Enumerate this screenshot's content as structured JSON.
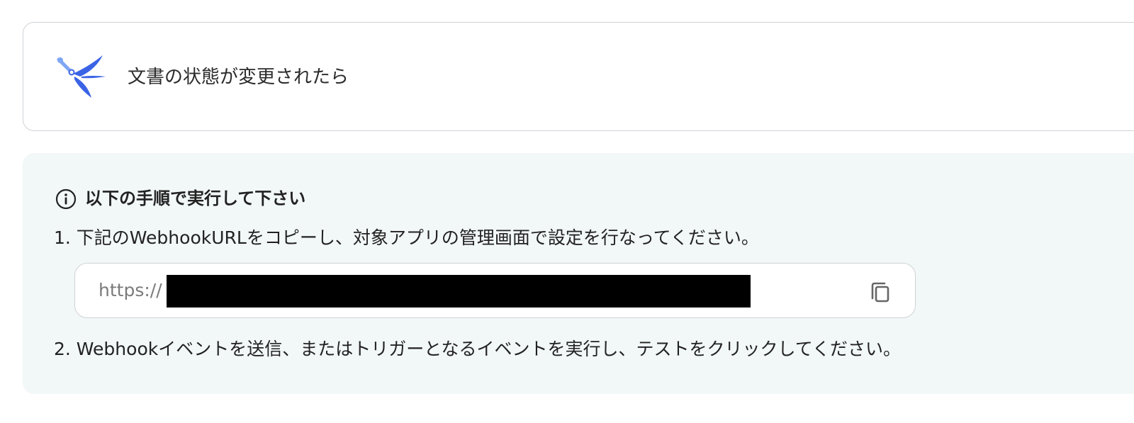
{
  "trigger": {
    "logo_icon": "swallow-bird-logo-icon",
    "title": "文書の状態が変更されたら"
  },
  "instructions": {
    "icon": "info-circle-icon",
    "heading": "以下の手順で実行して下さい",
    "step1": "1. 下記のWebhookURLをコピーし、対象アプリの管理画面で設定を行なってください。",
    "webhook_url_prefix": "https://",
    "copy_icon": "copy-icon",
    "step2": "2. Webhookイベントを送信、またはトリガーとなるイベントを実行し、テストをクリックしてください。"
  },
  "colors": {
    "logo_blue": "#3b63e6",
    "logo_light_blue": "#7fa6f5",
    "panel_background": "#f2f7f7",
    "border": "#cfd3d8"
  }
}
